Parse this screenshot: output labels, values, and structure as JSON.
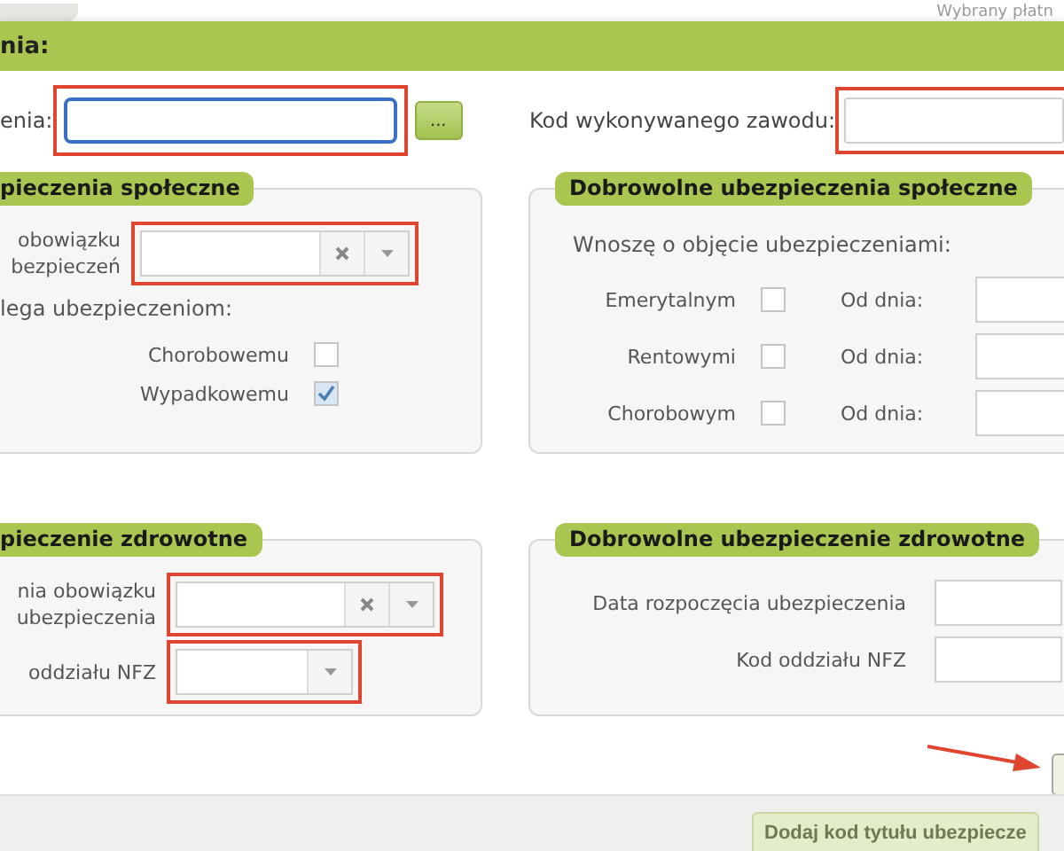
{
  "background": {
    "status_text": "Wybrany płatn",
    "button": "Dodaj kod tytułu ubezpiecze"
  },
  "dialog": {
    "title": "nia:",
    "main_field": {
      "label": "enia:",
      "browse_button": "...",
      "highlighted": true,
      "focused": true
    },
    "occupation_field": {
      "label": "Kod wykonywanego zawodu:",
      "highlighted": true
    },
    "social_insurance": {
      "title": "pieczenia społeczne",
      "fields": [
        {
          "label": "obowiązku bezpieczeń",
          "kind": "clearable",
          "highlighted": true
        }
      ],
      "subtitle": "lega ubezpieczeniom:",
      "checkboxes": [
        {
          "label": "Chorobowemu",
          "checked": false
        },
        {
          "label": "Wypadkowemu",
          "checked": true
        }
      ]
    },
    "voluntary_social": {
      "title": "Dobrowolne ubezpieczenia społeczne",
      "subtitle": "Wnoszę o objęcie ubezpieczeniami:",
      "rows": [
        {
          "label": "Emerytalnym",
          "checked": false,
          "date_label": "Od dnia:"
        },
        {
          "label": "Rentowymi",
          "checked": false,
          "date_label": "Od dnia:"
        },
        {
          "label": "Chorobowym",
          "checked": false,
          "date_label": "Od dnia:"
        }
      ]
    },
    "health_insurance": {
      "title": "pieczenie zdrowotne",
      "fields": [
        {
          "label": "nia obowiązku ubezpieczenia",
          "kind": "clearable",
          "highlighted": true
        },
        {
          "label": "oddziału NFZ",
          "kind": "select",
          "highlighted": true
        }
      ]
    },
    "voluntary_health": {
      "title": "Dobrowolne ubezpieczenie zdrowotne",
      "fields": [
        {
          "label": "Data rozpoczęcia ubezpieczenia"
        },
        {
          "label": "Kod oddziału NFZ"
        }
      ]
    }
  }
}
